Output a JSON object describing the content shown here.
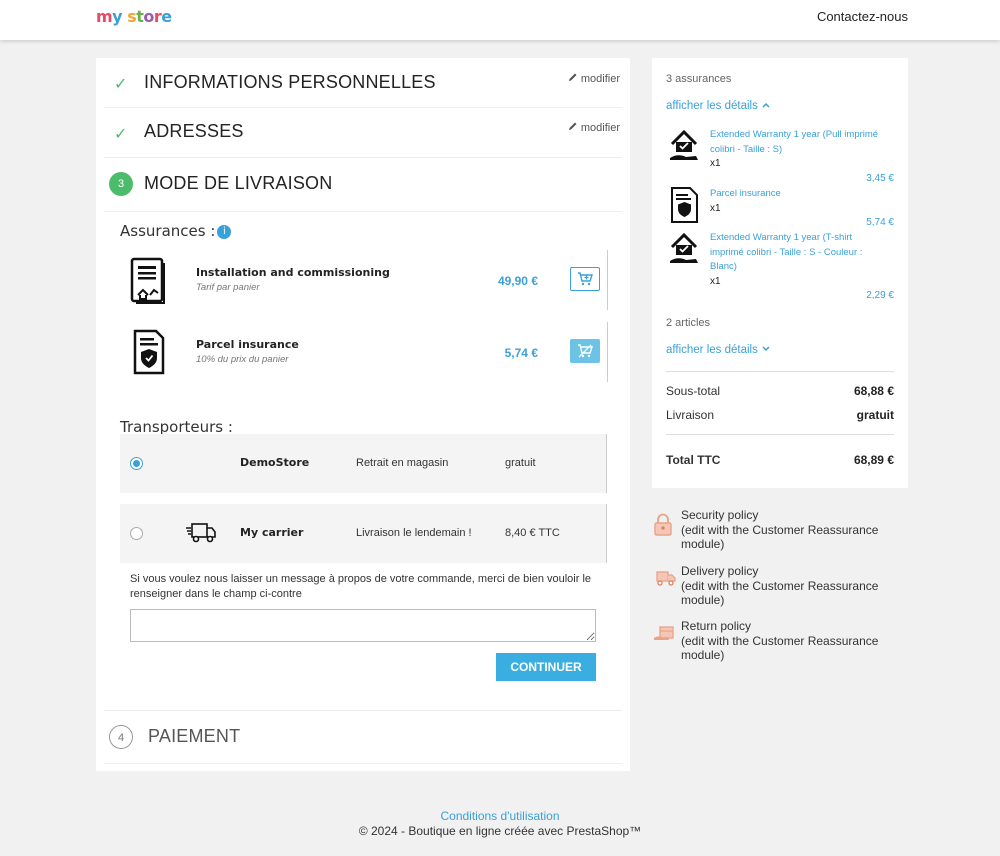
{
  "header": {
    "logo": {
      "part1": "my",
      "part2": "store"
    },
    "contact_label": "Contactez-nous"
  },
  "steps": [
    {
      "title": "INFORMATIONS PERSONNELLES",
      "edit_label": "modifier",
      "status": "complete"
    },
    {
      "title": "ADRESSES",
      "edit_label": "modifier",
      "status": "complete"
    },
    {
      "number": "3",
      "title": "MODE DE LIVRAISON",
      "status": "current"
    },
    {
      "number": "4",
      "title": "PAIEMENT",
      "status": "upcoming"
    }
  ],
  "insurance": {
    "label": "Assurances :",
    "info_icon": "info-icon",
    "items": [
      {
        "name": "Installation and commissioning",
        "subtitle": "Tarif par panier",
        "price": "49,90 €",
        "icon": "certificate-house-icon",
        "in_cart": false
      },
      {
        "name": "Parcel insurance",
        "subtitle": "10% du prix du panier",
        "price": "5,74 €",
        "icon": "shield-document-icon",
        "in_cart": true
      }
    ]
  },
  "carriers": {
    "label": "Transporteurs :",
    "items": [
      {
        "name": "DemoStore",
        "delay": "Retrait en magasin",
        "price": "gratuit",
        "selected": true
      },
      {
        "name": "My carrier",
        "delay": "Livraison le lendemain !",
        "price": "8,40 € TTC",
        "selected": false,
        "icon": "truck-icon"
      }
    ]
  },
  "message": {
    "label": "Si vous voulez nous laisser un message à propos de votre commande, merci de bien vouloir le renseigner dans le champ ci-contre",
    "value": ""
  },
  "continue_label": "CONTINUER",
  "summary": {
    "insurance_count": "3 assurances",
    "show_details_1": "afficher les détails",
    "insurance_items": [
      {
        "name": "Extended Warranty 1 year (Pull imprimé colibri - Taille : S)",
        "qty": "x1",
        "price": "3,45 €",
        "icon": "house-hand-icon"
      },
      {
        "name": "Parcel insurance",
        "qty": "x1",
        "price": "5,74 €",
        "icon": "shield-document-icon"
      },
      {
        "name": "Extended Warranty 1 year (T-shirt imprimé colibri - Taille : S - Couleur : Blanc)",
        "qty": "x1",
        "price": "2,29 €",
        "icon": "house-hand-icon"
      }
    ],
    "article_count": "2 articles",
    "show_details_2": "afficher les détails",
    "subtotal_label": "Sous-total",
    "subtotal_value": "68,88 €",
    "shipping_label": "Livraison",
    "shipping_value": "gratuit",
    "total_label": "Total TTC",
    "total_value": "68,89 €"
  },
  "reassurance": [
    {
      "title": "Security policy",
      "body": "(edit with the Customer Reassurance module)",
      "icon": "lock-icon"
    },
    {
      "title": "Delivery policy",
      "body": "(edit with the Customer Reassurance module)",
      "icon": "delivery-truck-icon"
    },
    {
      "title": "Return policy",
      "body": "(edit with the Customer Reassurance module)",
      "icon": "return-box-icon"
    }
  ],
  "footer": {
    "link": "Conditions d'utilisation",
    "copyright": "© 2024 - Boutique en ligne créée avec PrestaShop™"
  },
  "colors": {
    "accent": "#3aa0d8",
    "success": "#4cbb6c",
    "button": "#3aaee0"
  }
}
